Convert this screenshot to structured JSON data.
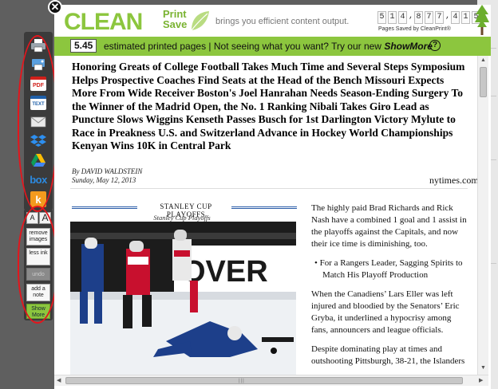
{
  "header": {
    "logo_clean": "CLEAN",
    "logo_print": "Print",
    "logo_save": "Save",
    "tagline": "brings you efficient content output.",
    "counter_digits": [
      "5",
      "1",
      "4",
      ",",
      "8",
      "7",
      "7",
      ",",
      "4",
      "1",
      "5"
    ],
    "saved_by": "Pages Saved by CleanPrint®",
    "close_label": "✕"
  },
  "bar": {
    "pages_count": "5.45",
    "text_prefix": "estimated printed pages  |  Not seeing what you want? Try our new ",
    "showmore": "ShowMore",
    "help": "?"
  },
  "toolbar": {
    "items": [
      "print-icon",
      "printer-select-icon",
      "pdf-icon",
      "text-icon",
      "email-icon",
      "dropbox-icon",
      "google-drive-icon",
      "box-icon",
      "kindle-icon"
    ],
    "pdf_label": "PDF",
    "text_label": "TEXT",
    "box_label": "box",
    "kindle_label": "k"
  },
  "actions": {
    "font_small": "A",
    "font_large": "A",
    "remove_images": "remove images",
    "less_ink": "less ink",
    "undo": "undo",
    "add_note": "add a note",
    "show_more": "Show More"
  },
  "article": {
    "headline": "Honoring Greats of College Football Takes Much Time and Several Steps Symposium Helps Prospective Coaches Find Seats at the Head of the Bench Missouri Expects More From Wide Receiver Boston's Joel Hanrahan Needs Season-Ending Surgery To the Winner of the Madrid Open, the No. 1 Ranking Nibali Takes Giro Lead as Puncture Slows Wiggins Kenseth Passes Busch for 1st Darlington Victory Mylute to Race in Preakness U.S. and Switzerland Advance in Hockey World Championships Kenyan Wins 10K in Central Park",
    "byline": "By DAVID WALDSTEIN",
    "date": "Sunday, May 12, 2013",
    "source": "nytimes.com",
    "caption_title": "STANLEY CUP PLAYOFFS",
    "caption_sub": "Stanley Cup Playoffs",
    "photo_text": "OVER",
    "para1": "The highly paid Brad Richards and Rick Nash have a combined 1 goal and 1 assist in the playoffs against the Capitals, and now their ice time is diminishing, too.",
    "bullet": "For a Rangers Leader, Sagging Spirits to Match His Playoff Production",
    "para2": "When the Canadiens’ Lars Eller was left injured and bloodied by the Senators’ Eric Gryba, it underlined a hypocrisy among fans, announcers and league officials.",
    "para3": "Despite dominating play at times and outshooting Pittsburgh, 38-21, the Islanders"
  }
}
